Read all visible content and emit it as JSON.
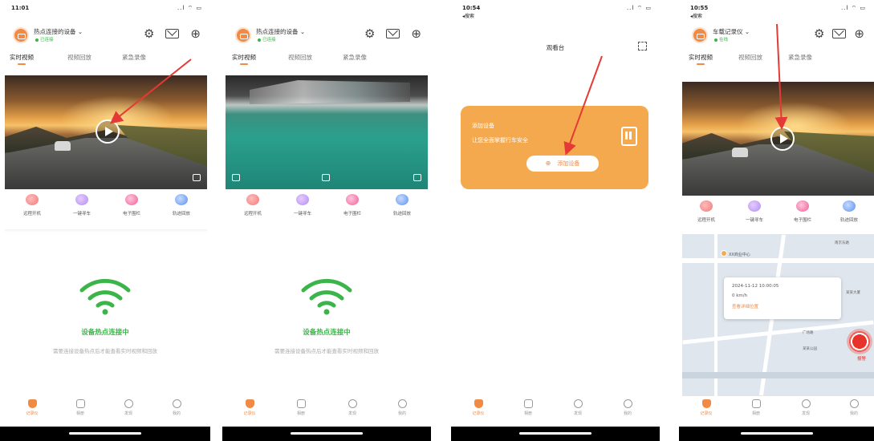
{
  "screens": [
    {
      "status": {
        "time": "11:01",
        "signal": "..l ⌔ ▭"
      },
      "header": {
        "device_name": "热点连接的设备 ⌄",
        "device_state": "已连接"
      },
      "tabs": [
        "实时视频",
        "视频回放",
        "紧急录像"
      ],
      "quick_actions": [
        "远程开机",
        "一键寻车",
        "电子围栏",
        "轨迹回放"
      ],
      "wifi": {
        "title": "设备热点连接中",
        "subtitle": "需要连接设备热点后才能查看实时视频和回放"
      },
      "nav": [
        "记录仪",
        "相册",
        "发现",
        "我的"
      ]
    },
    {
      "status": {
        "time": "",
        "signal": ""
      },
      "header": {
        "device_name": "热点连接的设备 ⌄",
        "device_state": "已连接"
      },
      "tabs": [
        "实时视频",
        "视频回放",
        "紧急录像"
      ],
      "quick_actions": [
        "远程开机",
        "一键寻车",
        "电子围栏",
        "轨迹回放"
      ],
      "wifi": {
        "title": "设备热点连接中",
        "subtitle": "需要连接设备热点后才能查看实时视频和回放"
      },
      "nav": [
        "记录仪",
        "相册",
        "发现",
        "我的"
      ]
    },
    {
      "status": {
        "time": "10:54",
        "sub": "◂搜索",
        "signal": "..l ⌔ ▭"
      },
      "title": "观看台",
      "card": {
        "line1": "添加设备",
        "line2": "让您全面掌握行车安全",
        "button": "添加设备"
      },
      "nav": [
        "记录仪",
        "相册",
        "发现",
        "我的"
      ]
    },
    {
      "status": {
        "time": "10:55",
        "sub": "◂搜索",
        "signal": "..l ⌔ ▭"
      },
      "header": {
        "device_name": "车载记录仪 ⌄",
        "device_state": "在线"
      },
      "tabs": [
        "实时视频",
        "视频回放",
        "紧急录像"
      ],
      "quick_actions": [
        "远程开机",
        "一键寻车",
        "电子围栏",
        "轨迹回放"
      ],
      "map": {
        "pin_label": "XX商业中心",
        "popup_time": "2024-11-12 10:00:05",
        "popup_speed": "0 km/h",
        "popup_address": "查看详细位置",
        "sos_label": "报警",
        "labels": [
          "南京东路",
          "某某大厦",
          "广场路",
          "某某公园"
        ]
      },
      "nav": [
        "记录仪",
        "相册",
        "发现",
        "我的"
      ]
    }
  ],
  "colors": {
    "accent": "#f08a45",
    "green": "#3bb54a",
    "card": "#f5a94e",
    "arrow": "#e53935",
    "sos": "#e8332a"
  }
}
